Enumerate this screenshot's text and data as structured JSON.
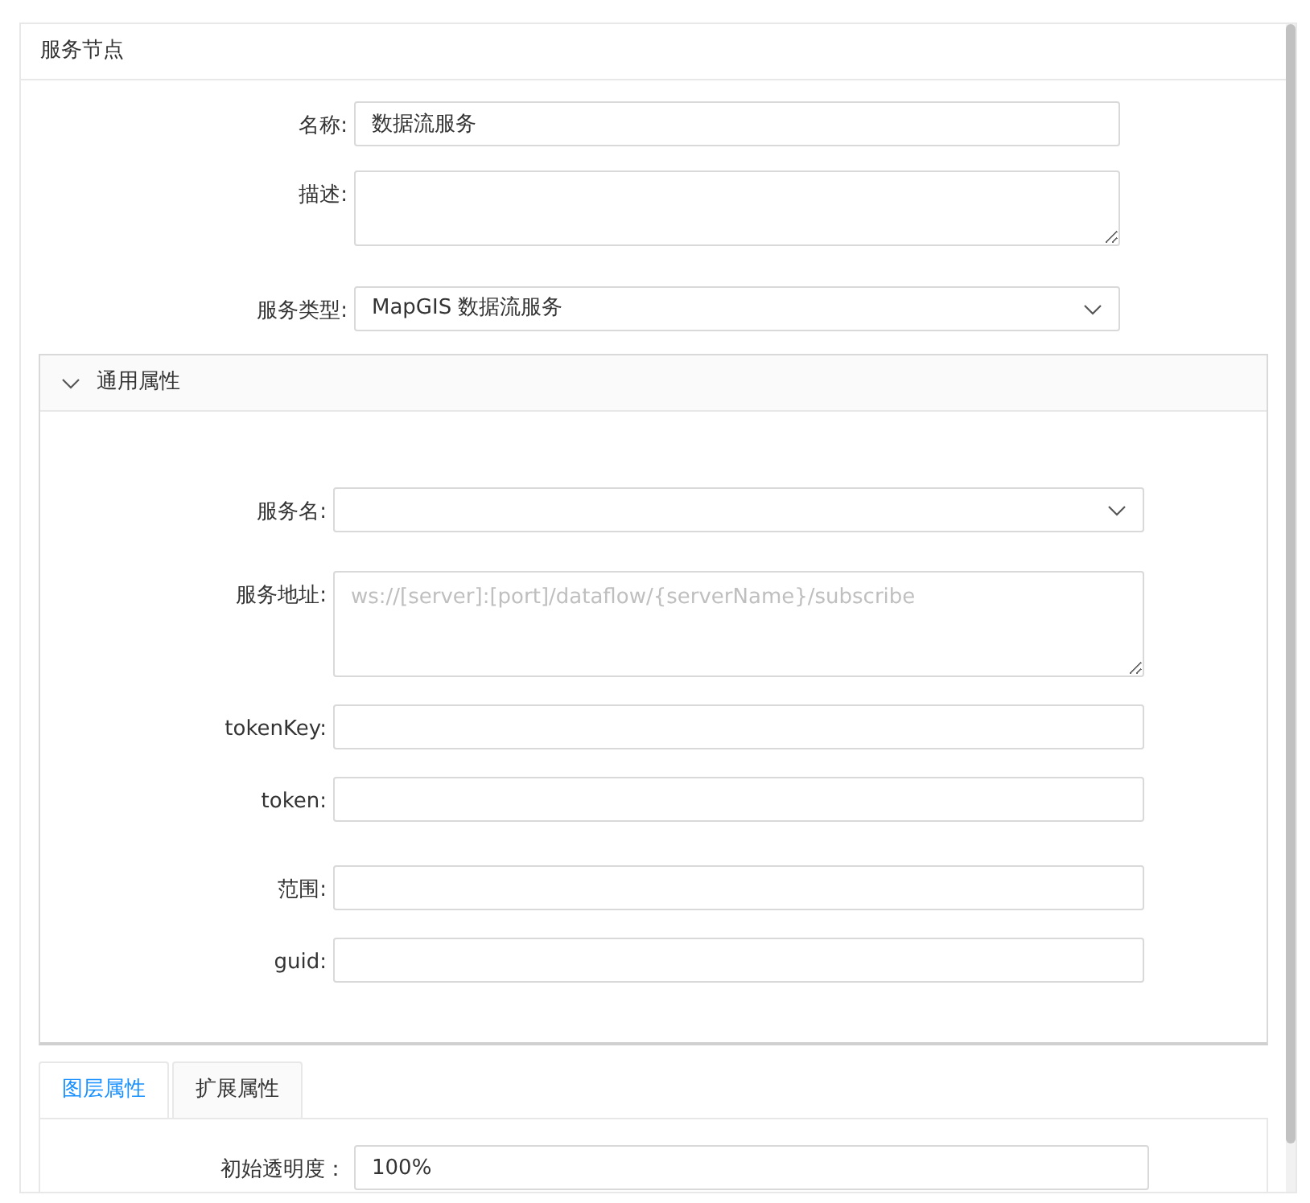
{
  "panel": {
    "title": "服务节点"
  },
  "fields": [
    {
      "label": "名称:",
      "kind": "input",
      "value": "数据流服务"
    },
    {
      "label": "描述:",
      "kind": "textarea"
    },
    {
      "label": "服务类型:",
      "kind": "select",
      "value": "MapGIS 数据流服务"
    }
  ],
  "section": {
    "title": "通用属性",
    "expanded": true,
    "fields": [
      {
        "label": "服务名:",
        "kind": "select"
      },
      {
        "label": "服务地址:",
        "kind": "textarea",
        "placeholder": "ws://[server]:[port]/dataflow/{serverName}/subscribe"
      },
      {
        "label": "tokenKey:",
        "kind": "input"
      },
      {
        "label": "token:",
        "kind": "input"
      },
      {
        "label": "范围:",
        "kind": "input"
      },
      {
        "label": "guid:",
        "kind": "input"
      }
    ]
  },
  "tabs": [
    {
      "label": "图层属性",
      "selected": true
    },
    {
      "label": "扩展属性",
      "selected": false
    }
  ],
  "tab_fields": [
    {
      "label": "初始透明度：",
      "kind": "input",
      "value": "100%"
    }
  ]
}
